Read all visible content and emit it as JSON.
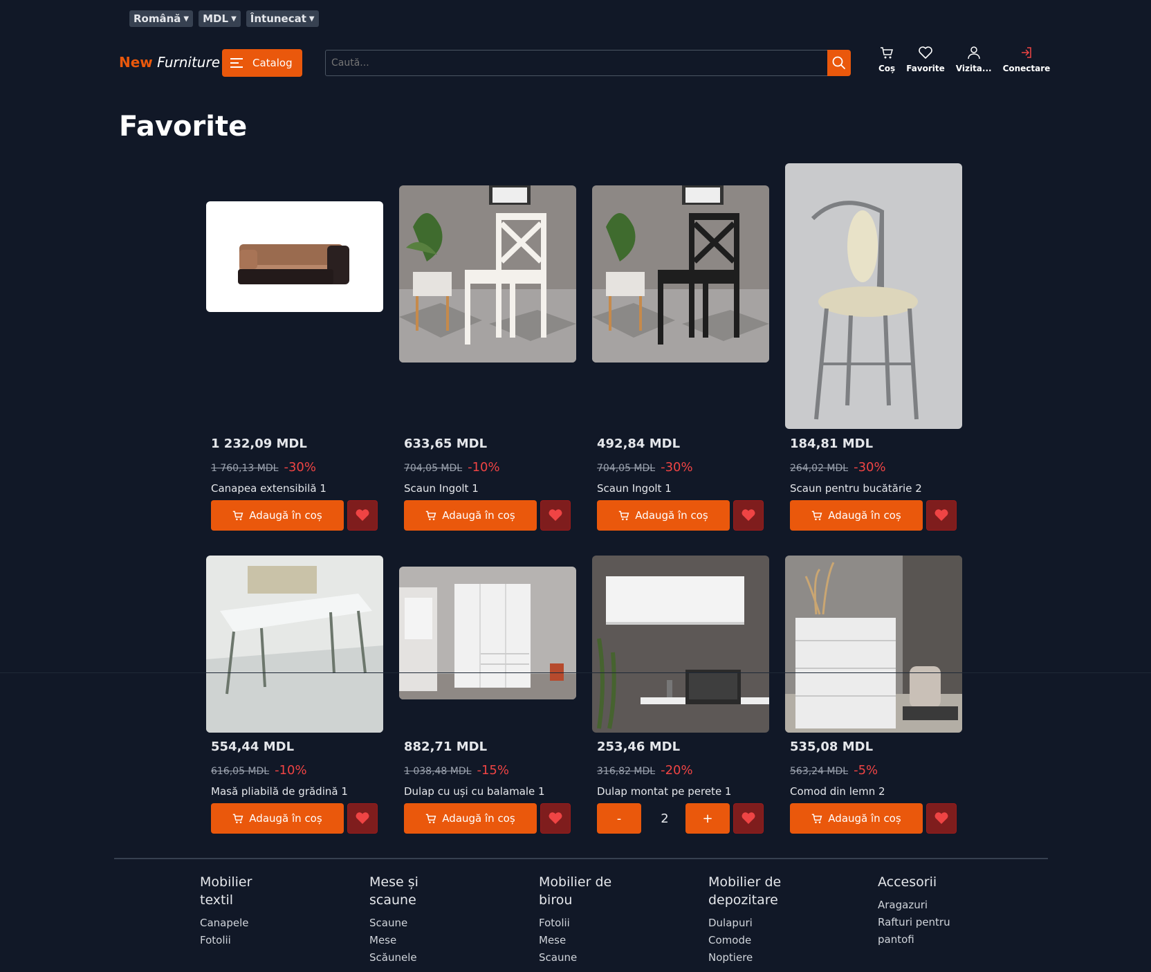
{
  "topbar": {
    "language": "Română",
    "currency": "MDL",
    "theme": "Întunecat"
  },
  "header": {
    "logo_new": "New",
    "logo_furniture": "Furniture",
    "catalog_label": "Catalog",
    "search_placeholder": "Caută...",
    "nav": {
      "cart": "Coș",
      "favorites": "Favorite",
      "visitor": "Vizita...",
      "login": "Conectare"
    }
  },
  "page_title": "Favorite",
  "add_to_cart_label": "Adaugă în coș",
  "products": [
    {
      "price": "1 232,09 MDL",
      "old_price": "1 760,13 MDL",
      "discount": "-30%",
      "name": "Canapea extensibilă 1",
      "image": "sofa"
    },
    {
      "price": "633,65 MDL",
      "old_price": "704,05 MDL",
      "discount": "-10%",
      "name": "Scaun Ingolt 1",
      "image": "white-chair"
    },
    {
      "price": "492,84 MDL",
      "old_price": "704,05 MDL",
      "discount": "-30%",
      "name": "Scaun Ingolt 1",
      "image": "black-chair"
    },
    {
      "price": "184,81 MDL",
      "old_price": "264,02 MDL",
      "discount": "-30%",
      "name": "Scaun pentru bucătărie 2",
      "image": "kitchen-chair"
    },
    {
      "price": "554,44 MDL",
      "old_price": "616,05 MDL",
      "discount": "-10%",
      "name": "Masă pliabilă de grădină 1",
      "image": "folding-table"
    },
    {
      "price": "882,71 MDL",
      "old_price": "1 038,48 MDL",
      "discount": "-15%",
      "name": "Dulap cu uși cu balamale 1",
      "image": "wardrobe"
    },
    {
      "price": "253,46 MDL",
      "old_price": "316,82 MDL",
      "discount": "-20%",
      "name": "Dulap montat pe perete 1",
      "image": "wall-cabinet",
      "quantity": "2",
      "qty_minus": "-",
      "qty_plus": "+"
    },
    {
      "price": "535,08 MDL",
      "old_price": "563,24 MDL",
      "discount": "-5%",
      "name": "Comod din lemn 2",
      "image": "dresser"
    }
  ],
  "footer": [
    {
      "title": "Mobilier textil",
      "links": [
        "Canapele",
        "Fotolii"
      ]
    },
    {
      "title": "Mese și scaune",
      "links": [
        "Scaune",
        "Mese",
        "Scăunele"
      ]
    },
    {
      "title": "Mobilier de birou",
      "links": [
        "Fotolii",
        "Mese",
        "Scaune"
      ]
    },
    {
      "title": "Mobilier de depozitare",
      "links": [
        "Dulapuri",
        "Comode",
        "Noptiere"
      ]
    },
    {
      "title": "Accesorii",
      "links": [
        "Aragazuri",
        "Rafturi pentru pantofi"
      ]
    }
  ],
  "colors": {
    "accent": "#ea580c",
    "background": "#111827",
    "discount": "#ef4444",
    "favorite": "#7f1d1d"
  }
}
